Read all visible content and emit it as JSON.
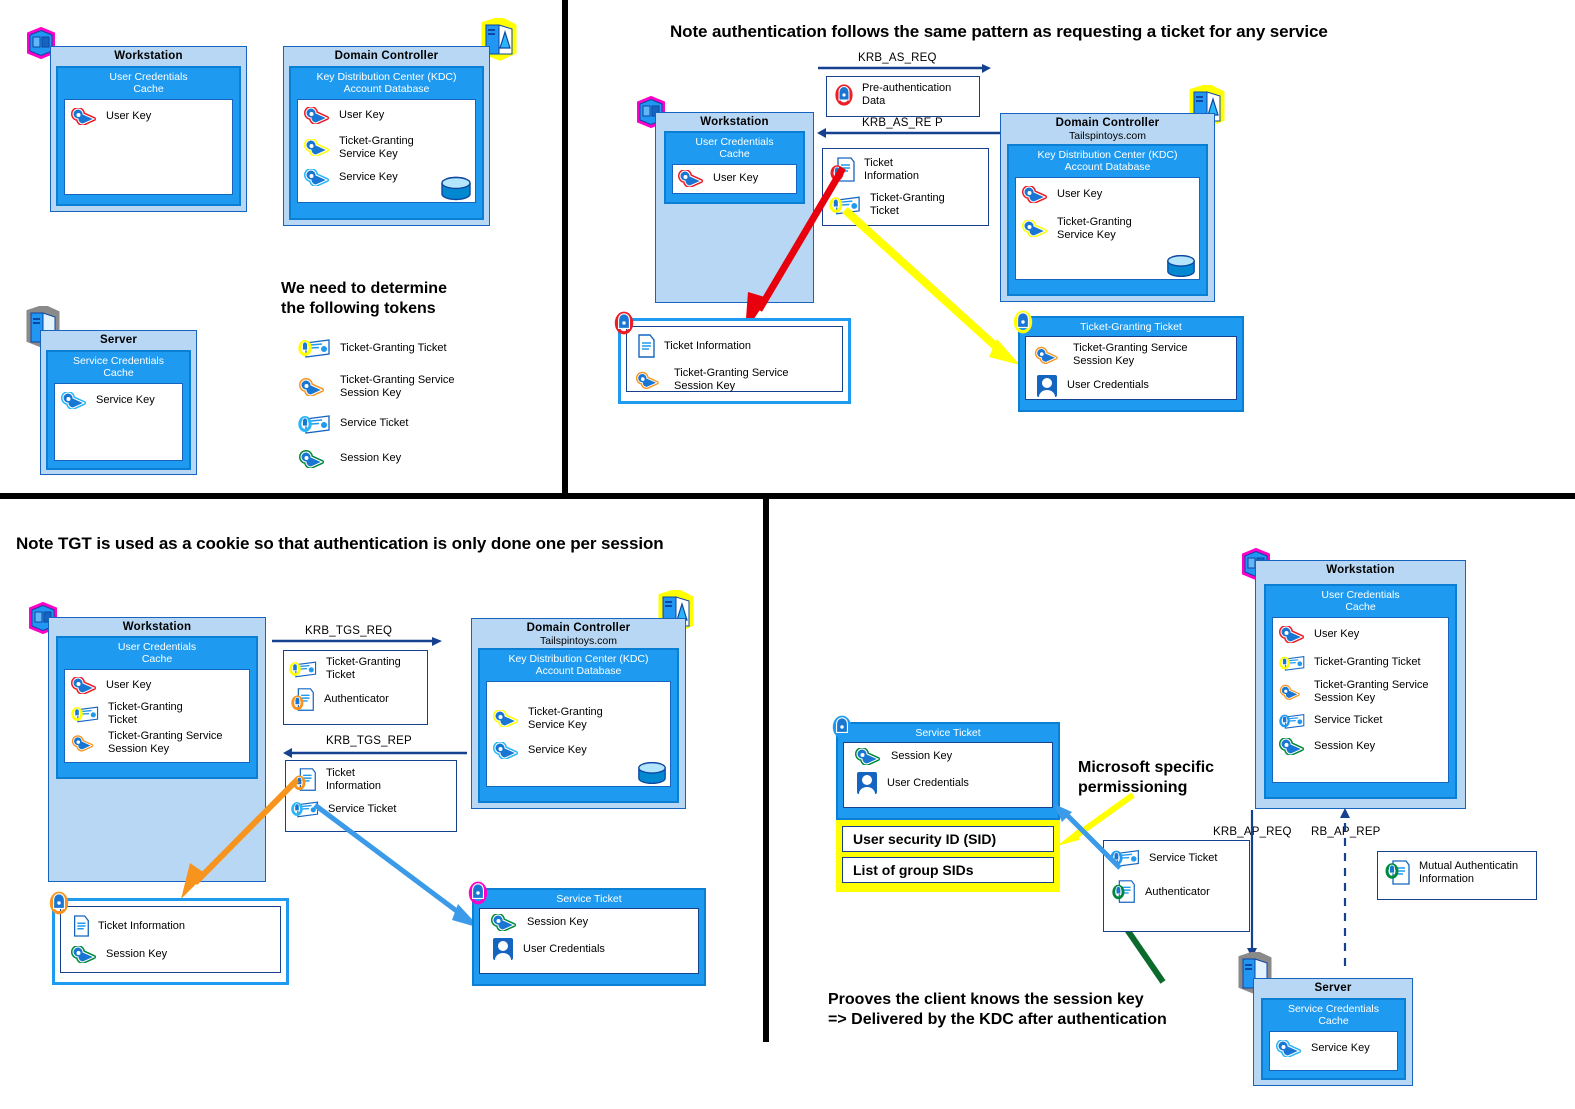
{
  "dividers": {
    "note": "black separator lines"
  },
  "q1": {
    "workstation": {
      "title": "Workstation",
      "cache_title": "User Credentials\nCache",
      "items": [
        {
          "icon": "key-red-icon",
          "label": "User Key"
        }
      ]
    },
    "domain_controller": {
      "title": "Domain Controller",
      "cache_title": "Key Distribution Center (KDC)\nAccount Database",
      "items": [
        {
          "icon": "key-red-icon",
          "label": "User Key"
        },
        {
          "icon": "key-yellow-icon",
          "label": "Ticket-Granting\nService Key"
        },
        {
          "icon": "key-blue-icon",
          "label": "Service Key"
        }
      ]
    },
    "server": {
      "title": "Server",
      "cache_title": "Service Credentials\nCache",
      "items": [
        {
          "icon": "key-blue-icon",
          "label": "Service Key"
        }
      ]
    },
    "legend": {
      "heading": "We need to determine\nthe following tokens",
      "items": [
        {
          "icon": "ticket-yellow-icon",
          "label": "Ticket-Granting Ticket"
        },
        {
          "icon": "key-orange-icon",
          "label": "Ticket-Granting Service\nSession Key"
        },
        {
          "icon": "ticket-blue-icon",
          "label": "Service Ticket"
        },
        {
          "icon": "key-green-icon",
          "label": "Session Key"
        }
      ]
    }
  },
  "q2": {
    "headline": "Note authentication follows the same pattern as requesting a ticket for any service",
    "arrow_req_label": "KRB_AS_REQ",
    "arrow_rep_label": "KRB_AS_RE P",
    "req_box": [
      {
        "icon": "lock-red-icon",
        "label": "Pre-authentication\nData"
      }
    ],
    "rep_box": [
      {
        "icon": "doc-red-icon",
        "label": "Ticket\nInformation"
      },
      {
        "icon": "ticket-yellow-icon",
        "label": "Ticket-Granting\nTicket"
      }
    ],
    "workstation": {
      "title": "Workstation",
      "cache_title": "User Credentials\nCache",
      "items": [
        {
          "icon": "key-red-icon",
          "label": "User Key"
        }
      ]
    },
    "domain_controller": {
      "title": "Domain Controller",
      "subtitle": "Tailspintoys.com",
      "cache_title": "Key Distribution Center (KDC)\nAccount Database",
      "items": [
        {
          "icon": "key-red-icon",
          "label": "User Key"
        },
        {
          "icon": "key-yellow-icon",
          "label": "Ticket-Granting\nService Key"
        }
      ]
    },
    "decrypted_box": [
      {
        "icon": "doc-plain-icon",
        "label": "Ticket Information"
      },
      {
        "icon": "key-orange-icon",
        "label": "Ticket-Granting Service\nSession Key"
      }
    ],
    "tgt_panel": {
      "title": "Ticket-Granting Ticket",
      "items": [
        {
          "icon": "key-orange-icon",
          "label": "Ticket-Granting Service\nSession Key"
        },
        {
          "icon": "user-icon",
          "label": "User Credentials"
        }
      ]
    }
  },
  "q3": {
    "headline": "Note TGT is used as a cookie so that authentication is only done one per session",
    "arrow_req_label": "KRB_TGS_REQ",
    "arrow_rep_label": "KRB_TGS_REP",
    "workstation": {
      "title": "Workstation",
      "cache_title": "User Credentials\nCache",
      "items": [
        {
          "icon": "key-red-icon",
          "label": "User Key"
        },
        {
          "icon": "ticket-yellow-icon",
          "label": "Ticket-Granting\nTicket"
        },
        {
          "icon": "key-orange-icon",
          "label": "Ticket-Granting Service\nSession Key"
        }
      ]
    },
    "req_box": [
      {
        "icon": "ticket-yellow-icon",
        "label": "Ticket-Granting\nTicket"
      },
      {
        "icon": "doc-orange-icon",
        "label": "Authenticator"
      }
    ],
    "rep_box": [
      {
        "icon": "doc-orange-icon",
        "label": "Ticket\nInformation"
      },
      {
        "icon": "ticket-blue-icon",
        "label": "Service Ticket"
      }
    ],
    "domain_controller": {
      "title": "Domain Controller",
      "subtitle": "Tailspintoys.com",
      "cache_title": "Key Distribution Center (KDC)\nAccount Database",
      "items": [
        {
          "icon": "key-yellow-icon",
          "label": "Ticket-Granting\nService Key"
        },
        {
          "icon": "key-blue-icon",
          "label": "Service Key"
        }
      ]
    },
    "decrypted_box": [
      {
        "icon": "doc-plain-icon",
        "label": "Ticket Information"
      },
      {
        "icon": "key-green-icon",
        "label": "Session Key"
      }
    ],
    "service_ticket_panel": {
      "title": "Service Ticket",
      "items": [
        {
          "icon": "key-green-icon",
          "label": "Session Key"
        },
        {
          "icon": "user-icon",
          "label": "User Credentials"
        }
      ]
    }
  },
  "q4": {
    "service_ticket_panel": {
      "title": "Service Ticket",
      "items": [
        {
          "icon": "key-green-icon",
          "label": "Session Key"
        },
        {
          "icon": "user-icon",
          "label": "User Credentials"
        }
      ],
      "sid_rows": [
        "User security ID (SID)",
        "List of group SIDs"
      ]
    },
    "ms_callout": "Microsoft specific\npermissioning",
    "proof_callout": "Prooves the client knows the session key\n=> Delivered by the KDC after authentication",
    "ap_req_box": [
      {
        "icon": "ticket-blue-icon",
        "label": "Service Ticket"
      },
      {
        "icon": "doc-green-icon",
        "label": "Authenticator"
      }
    ],
    "arrow_req_label": "KRB_AP_REQ",
    "arrow_rep_label": "RB_AP_REP",
    "mutual_box": [
      {
        "icon": "doc-green-icon",
        "label": "Mutual Authenticatin\nInformation"
      }
    ],
    "workstation": {
      "title": "Workstation",
      "cache_title": "User Credentials\nCache",
      "items": [
        {
          "icon": "key-red-icon",
          "label": "User Key"
        },
        {
          "icon": "ticket-yellow-icon",
          "label": "Ticket-Granting Ticket"
        },
        {
          "icon": "key-orange-icon",
          "label": "Ticket-Granting Service\nSession Key"
        },
        {
          "icon": "ticket-blue-icon",
          "label": "Service Ticket"
        },
        {
          "icon": "key-green-icon",
          "label": "Session Key"
        }
      ]
    },
    "server": {
      "title": "Server",
      "cache_title": "Service Credentials\nCache",
      "items": [
        {
          "icon": "key-blue-icon",
          "label": "Service Key"
        }
      ]
    }
  },
  "colors": {
    "red": "#ee1c25",
    "yellow": "#ffff00",
    "orange": "#f7941e",
    "green": "#008a3c",
    "blue": "#1e9bf0",
    "darkblue": "#15418f",
    "panel": "#b7d7f4"
  }
}
